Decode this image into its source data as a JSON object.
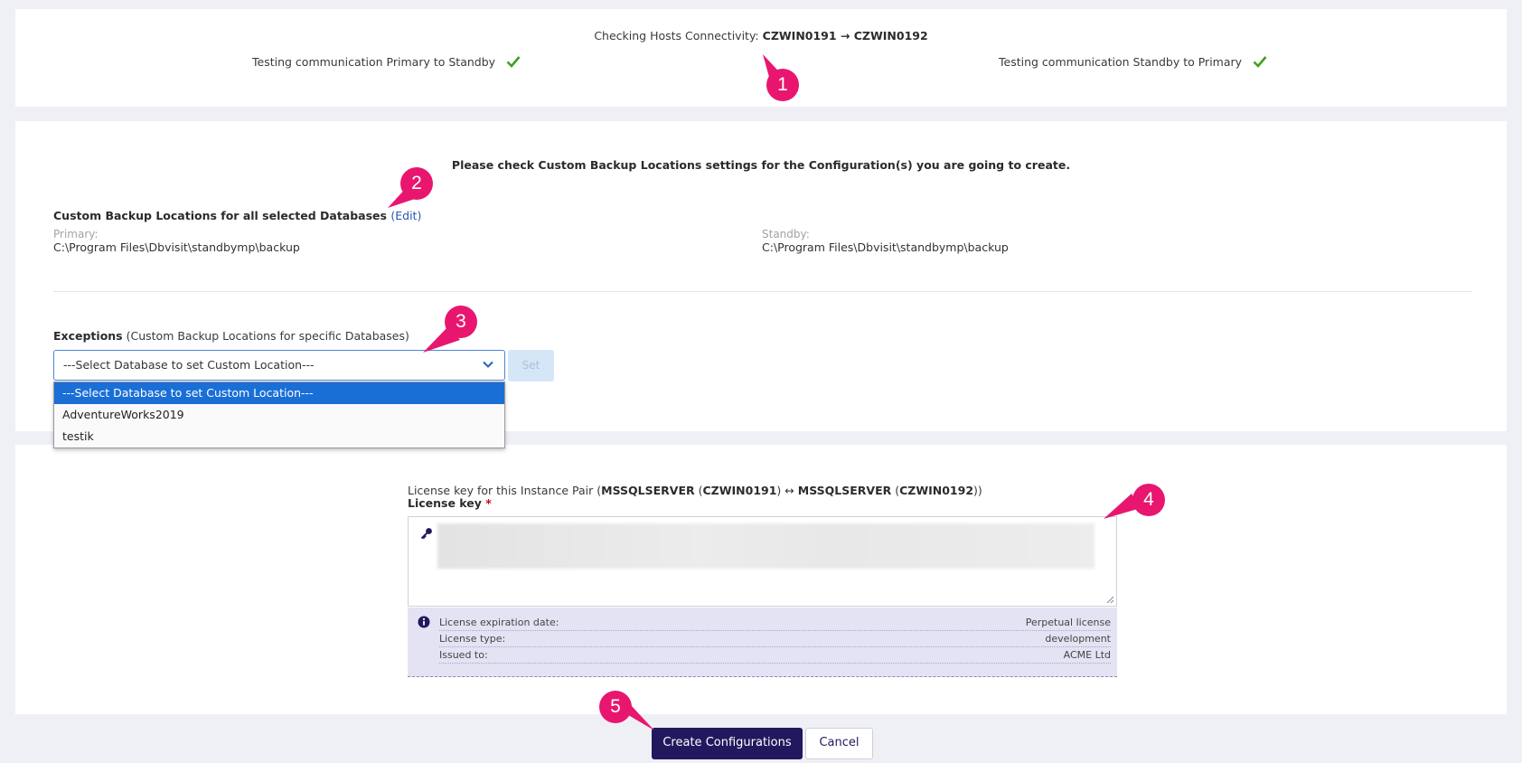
{
  "connectivity": {
    "heading_prefix": "Checking Hosts Connectivity:",
    "heading_hosts": "CZWIN0191 → CZWIN0192",
    "test_primary_to_standby": "Testing communication Primary to Standby",
    "test_standby_to_primary": "Testing communication Standby to Primary",
    "status_color": "#3fa11c"
  },
  "backup": {
    "notice": "Please check Custom Backup Locations settings for the Configuration(s) you are going to create.",
    "all_title": "Custom Backup Locations for all selected Databases",
    "edit_open": "(",
    "edit_label": "Edit",
    "edit_close": ")",
    "primary_label": "Primary:",
    "primary_path": "C:\\Program Files\\Dbvisit\\standbymp\\backup",
    "standby_label": "Standby:",
    "standby_path": "C:\\Program Files\\Dbvisit\\standbymp\\backup",
    "exceptions_title": "Exceptions",
    "exceptions_desc": "(Custom Backup Locations for specific Databases)",
    "select_value": "---Select Database to set Custom Location---",
    "set_button": "Set",
    "options": [
      "---Select Database to set Custom Location---",
      "AdventureWorks2019",
      "testik"
    ]
  },
  "license": {
    "pair_prefix": "License key for this Instance Pair (",
    "pair_instance1": "MSSQLSERVER",
    "pair_host1": "CZWIN0191",
    "pair_sep": "↔",
    "pair_instance2": "MSSQLSERVER",
    "pair_host2": "CZWIN0192",
    "key_label": "License key",
    "required_mark": "*",
    "info": [
      {
        "label": "License expiration date:",
        "value": "Perpetual license"
      },
      {
        "label": "License type:",
        "value": "development"
      },
      {
        "label": "Issued to:",
        "value": "ACME Ltd"
      }
    ]
  },
  "actions": {
    "create": "Create Configurations",
    "cancel": "Cancel"
  },
  "markers": [
    "1",
    "2",
    "3",
    "4",
    "5"
  ],
  "colors": {
    "accent": "#e8166f",
    "primary_button": "#22185e",
    "select_highlight": "#1a6fd6",
    "info_background": "#e3e3f3"
  },
  "icons": [
    "checkmark-icon",
    "chevron-down-icon",
    "key-icon",
    "info-icon",
    "arrow-pointer-icon"
  ]
}
